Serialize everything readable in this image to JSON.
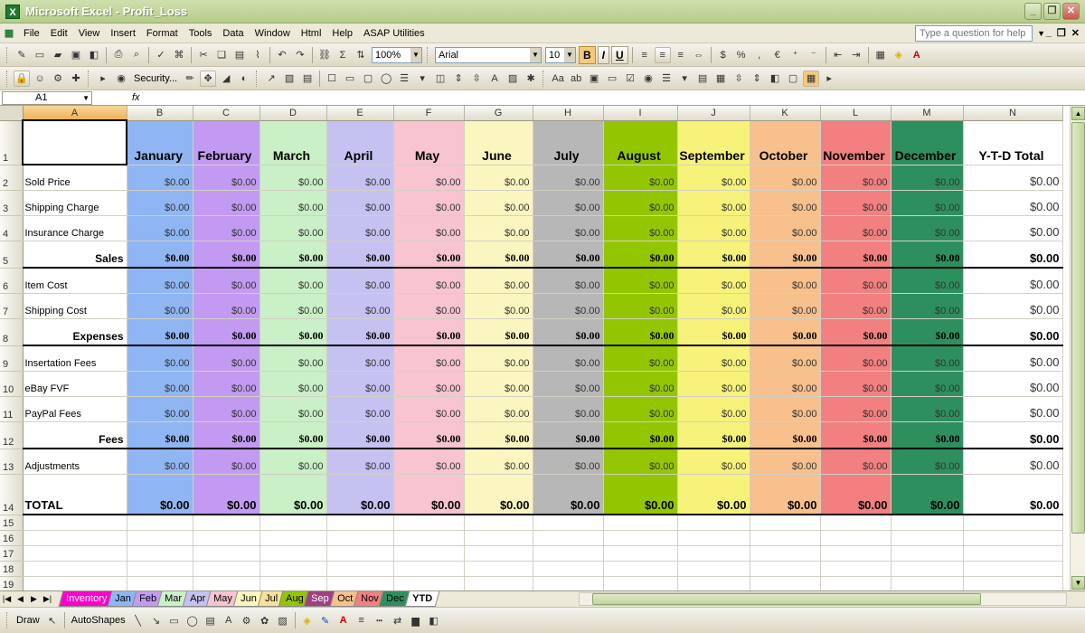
{
  "window": {
    "title": "Microsoft Excel - Profit_Loss",
    "app_icon": "X"
  },
  "menu": [
    "File",
    "Edit",
    "View",
    "Insert",
    "Format",
    "Tools",
    "Data",
    "Window",
    "Html",
    "Help",
    "ASAP Utilities"
  ],
  "help_box": {
    "placeholder": "Type a question for help"
  },
  "toolbar": {
    "zoom": "100%",
    "font": "Arial",
    "size": "10",
    "bold": "B",
    "italic": "I",
    "underline": "U",
    "currency": "$",
    "percent": "%",
    "euro": "€",
    "security_label": "Security..."
  },
  "formula_bar": {
    "name_box": "A1",
    "fx": "fx"
  },
  "columns": [
    "A",
    "B",
    "C",
    "D",
    "E",
    "F",
    "G",
    "H",
    "I",
    "J",
    "K",
    "L",
    "M",
    "N"
  ],
  "months": [
    "January",
    "February",
    "March",
    "April",
    "May",
    "June",
    "July",
    "August",
    "September",
    "October",
    "November",
    "December"
  ],
  "ytd_header": "Y-T-D Total",
  "month_colors": [
    "#8fb6f2",
    "#c39af2",
    "#c9f0c6",
    "#c5c2f2",
    "#f7c4d0",
    "#fbf6bf",
    "#b7b7b7",
    "#93c600",
    "#f7f27a",
    "#f7c08c",
    "#f28080",
    "#2e8f5e"
  ],
  "rows": [
    {
      "num": "2",
      "label": "Sold Price",
      "type": "item",
      "value": "$0.00"
    },
    {
      "num": "3",
      "label": "Shipping Charge",
      "type": "item",
      "value": "$0.00"
    },
    {
      "num": "4",
      "label": "Insurance Charge",
      "type": "item",
      "value": "$0.00"
    },
    {
      "num": "5",
      "label": "Sales",
      "type": "sub",
      "value": "$0.00"
    },
    {
      "num": "6",
      "label": "Item Cost",
      "type": "item",
      "value": "$0.00"
    },
    {
      "num": "7",
      "label": "Shipping Cost",
      "type": "item",
      "value": "$0.00"
    },
    {
      "num": "8",
      "label": "Expenses",
      "type": "sub",
      "value": "$0.00"
    },
    {
      "num": "9",
      "label": "Insertation Fees",
      "type": "item",
      "value": "$0.00"
    },
    {
      "num": "10",
      "label": "eBay FVF",
      "type": "item",
      "value": "$0.00"
    },
    {
      "num": "11",
      "label": "PayPal Fees",
      "type": "item",
      "value": "$0.00"
    },
    {
      "num": "12",
      "label": "Fees",
      "type": "sub",
      "value": "$0.00"
    },
    {
      "num": "13",
      "label": "Adjustments",
      "type": "item",
      "value": "$0.00"
    },
    {
      "num": "14",
      "label": "TOTAL",
      "type": "tot",
      "value": "$0.00"
    }
  ],
  "empty_rows": [
    "15",
    "16",
    "17",
    "18",
    "19"
  ],
  "header_row_num": "1",
  "sheet_tabs": [
    {
      "label": "Inventory",
      "color": "#ff00cc"
    },
    {
      "label": "Jan",
      "color": "#8fb6f2"
    },
    {
      "label": "Feb",
      "color": "#c39af2"
    },
    {
      "label": "Mar",
      "color": "#c9f0c6"
    },
    {
      "label": "Apr",
      "color": "#c5c2f2"
    },
    {
      "label": "May",
      "color": "#f7c4d0"
    },
    {
      "label": "Jun",
      "color": "#fbf6bf"
    },
    {
      "label": "Jul",
      "color": "#f5e19a"
    },
    {
      "label": "Aug",
      "color": "#93c600"
    },
    {
      "label": "Sep",
      "color": "#a04080"
    },
    {
      "label": "Oct",
      "color": "#f7c08c"
    },
    {
      "label": "Nov",
      "color": "#f28080"
    },
    {
      "label": "Dec",
      "color": "#2e8f5e"
    },
    {
      "label": "YTD",
      "color": "#ffffff"
    }
  ],
  "drawbar": {
    "draw": "Draw",
    "autoshapes": "AutoShapes"
  }
}
